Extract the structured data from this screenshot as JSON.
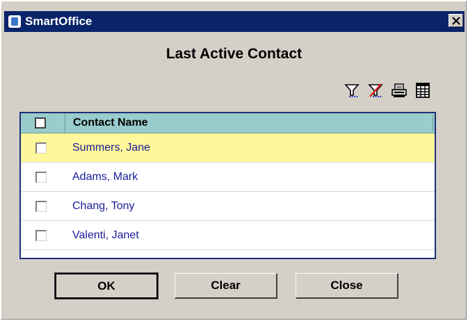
{
  "window": {
    "title": "SmartOffice",
    "close_glyph": "✕"
  },
  "dialog": {
    "heading": "Last Active Contact"
  },
  "toolbar": {
    "icons": [
      "filter-icon",
      "clear-filter-icon",
      "print-icon",
      "grid-icon"
    ]
  },
  "grid": {
    "columns": [
      "",
      "Contact Name"
    ],
    "rows": [
      {
        "name": "Summers, Jane",
        "checked": false,
        "selected": true
      },
      {
        "name": "Adams, Mark",
        "checked": false,
        "selected": false
      },
      {
        "name": "Chang, Tony",
        "checked": false,
        "selected": false
      },
      {
        "name": "Valenti, Janet",
        "checked": false,
        "selected": false
      }
    ]
  },
  "buttons": {
    "ok": "OK",
    "clear": "Clear",
    "close": "Close"
  },
  "colors": {
    "titlebar": "#0a246a",
    "header": "#99cccc",
    "selected_row": "#fff89a",
    "link_text": "#1a1a9a",
    "dialog_bg": "#d4d0c8"
  }
}
